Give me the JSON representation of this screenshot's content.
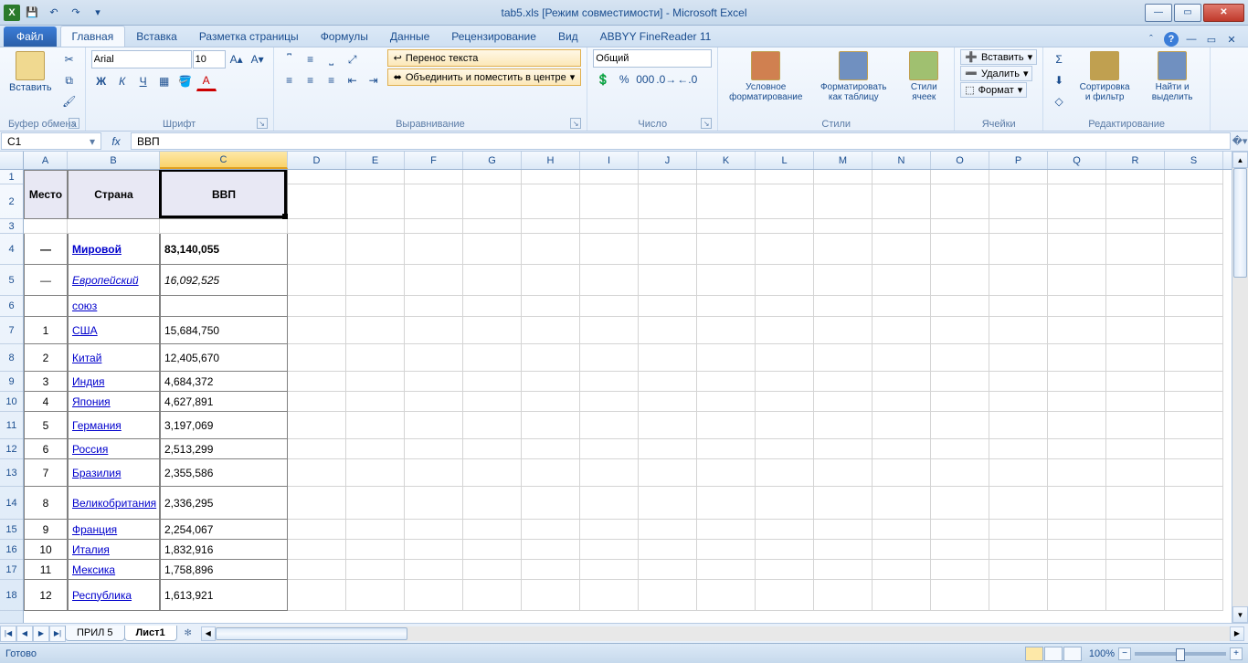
{
  "app": {
    "title": "tab5.xls  [Режим совместимости]  -  Microsoft Excel"
  },
  "tabs": {
    "file": "Файл",
    "items": [
      "Главная",
      "Вставка",
      "Разметка страницы",
      "Формулы",
      "Данные",
      "Рецензирование",
      "Вид",
      "ABBYY FineReader 11"
    ],
    "active_index": 0
  },
  "ribbon": {
    "clipboard": {
      "paste": "Вставить",
      "label": "Буфер обмена"
    },
    "font": {
      "name": "Arial",
      "size": "10",
      "bold": "Ж",
      "italic": "К",
      "underline": "Ч",
      "label": "Шрифт"
    },
    "alignment": {
      "wrap": "Перенос текста",
      "merge": "Объединить и поместить в центре",
      "label": "Выравнивание"
    },
    "number": {
      "format": "Общий",
      "label": "Число"
    },
    "styles": {
      "cond": "Условное форматирование",
      "table": "Форматировать как таблицу",
      "cell": "Стили ячеек",
      "label": "Стили"
    },
    "cells": {
      "insert": "Вставить",
      "delete": "Удалить",
      "format": "Формат",
      "label": "Ячейки"
    },
    "editing": {
      "sort": "Сортировка и фильтр",
      "find": "Найти и выделить",
      "label": "Редактирование"
    }
  },
  "formula_bar": {
    "name_box": "C1",
    "formula": "ВВП"
  },
  "columns": [
    "A",
    "B",
    "C",
    "D",
    "E",
    "F",
    "G",
    "H",
    "I",
    "J",
    "K",
    "L",
    "M",
    "N",
    "O",
    "P",
    "Q",
    "R",
    "S"
  ],
  "col_widths": {
    "A": 48,
    "B": 101,
    "C": 140,
    "default": 64
  },
  "selected_col_index": 2,
  "row_heights": {
    "1": 16,
    "2": 38,
    "3": 16,
    "4": 34,
    "5": 34,
    "6": 23,
    "7": 30,
    "8": 30,
    "9": 22,
    "10": 22,
    "11": 30,
    "12": 22,
    "13": 30,
    "14": 36,
    "15": 22,
    "16": 22,
    "17": 22,
    "18": 34
  },
  "selected_cell": {
    "col": 2,
    "row_top": 1,
    "row_bottom": 2
  },
  "table": {
    "headers": {
      "A": "Место",
      "B": "Страна",
      "C": "ВВП"
    },
    "rows": [
      {
        "r": 4,
        "place": "—",
        "country": "Мировой",
        "gdp": "83,140,055",
        "bold": true
      },
      {
        "r": 5,
        "place": "—",
        "country": "Европейский",
        "gdp": "16,092,525",
        "italic": true
      },
      {
        "r": 6,
        "place": "",
        "country": "союз",
        "gdp": ""
      },
      {
        "r": 7,
        "place": "1",
        "country": "США",
        "gdp": "15,684,750"
      },
      {
        "r": 8,
        "place": "2",
        "country": "Китай",
        "gdp": "12,405,670"
      },
      {
        "r": 9,
        "place": "3",
        "country": "Индия",
        "gdp": "4,684,372"
      },
      {
        "r": 10,
        "place": "4",
        "country": "Япония",
        "gdp": "4,627,891"
      },
      {
        "r": 11,
        "place": "5",
        "country": "Германия",
        "gdp": "3,197,069"
      },
      {
        "r": 12,
        "place": "6",
        "country": "Россия",
        "gdp": "2,513,299"
      },
      {
        "r": 13,
        "place": "7",
        "country": "Бразилия",
        "gdp": "2,355,586"
      },
      {
        "r": 14,
        "place": "8",
        "country": "Великобритания",
        "gdp": "2,336,295"
      },
      {
        "r": 15,
        "place": "9",
        "country": "Франция",
        "gdp": "2,254,067"
      },
      {
        "r": 16,
        "place": "10",
        "country": "Италия",
        "gdp": "1,832,916"
      },
      {
        "r": 17,
        "place": "11",
        "country": "Мексика",
        "gdp": "1,758,896"
      },
      {
        "r": 18,
        "place": "12",
        "country": "Республика",
        "gdp": "1,613,921"
      }
    ]
  },
  "sheet_tabs": {
    "items": [
      "ПРИЛ 5",
      "Лист1"
    ],
    "active_index": 1
  },
  "status": {
    "ready": "Готово",
    "zoom": "100%"
  }
}
